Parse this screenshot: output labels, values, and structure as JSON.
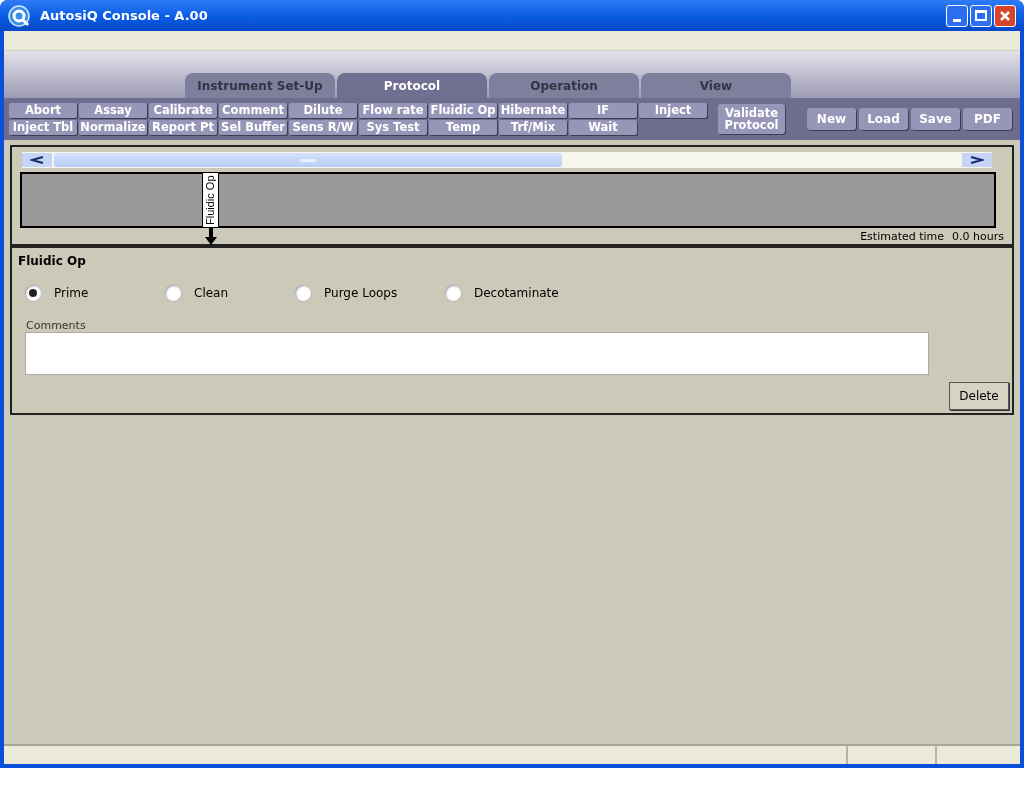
{
  "window": {
    "title": "AutosiQ Console - A.00"
  },
  "tabs": [
    {
      "label": "Instrument Set-Up",
      "selected": false
    },
    {
      "label": "Protocol",
      "selected": true
    },
    {
      "label": "Operation",
      "selected": false
    },
    {
      "label": "View",
      "selected": false
    }
  ],
  "step_buttons": [
    [
      "Abort",
      "Assay",
      "Calibrate",
      "Comment",
      "Dilute",
      "Flow rate",
      "Fluidic Op",
      "Hibernate",
      "IF",
      "Inject"
    ],
    [
      "Inject Tbl",
      "Normalize",
      "Report Pt",
      "Sel Buffer",
      "Sens R/W",
      "Sys Test",
      "Temp",
      "Trf/Mix",
      "Wait"
    ]
  ],
  "validate_button": [
    "Validate",
    "Protocol"
  ],
  "file_buttons": [
    "New",
    "Load",
    "Save",
    "PDF"
  ],
  "timeline": {
    "steps": [
      {
        "label": "Fluidic Op"
      }
    ],
    "estimated_time_label": "Estimated time",
    "estimated_time_value": "0.0 hours"
  },
  "detail": {
    "title": "Fluidic Op",
    "options": [
      {
        "label": "Prime",
        "selected": true
      },
      {
        "label": "Clean",
        "selected": false
      },
      {
        "label": "Purge Loops",
        "selected": false
      },
      {
        "label": "Decotaminate",
        "selected": false
      }
    ],
    "comments_label": "Comments",
    "delete_button": "Delete"
  }
}
